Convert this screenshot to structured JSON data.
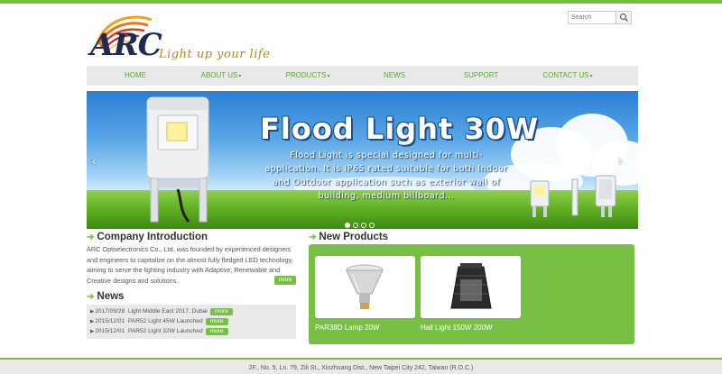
{
  "brand": {
    "logo_text": "ARC",
    "tagline": "Light up your life"
  },
  "search": {
    "placeholder": "Search",
    "icon": "search-icon"
  },
  "nav": {
    "items": [
      {
        "label": "HOME",
        "has_dropdown": false
      },
      {
        "label": "ABOUT US",
        "has_dropdown": true
      },
      {
        "label": "PRODUCTS",
        "has_dropdown": true
      },
      {
        "label": "NEWS",
        "has_dropdown": false
      },
      {
        "label": "SUPPORT",
        "has_dropdown": false
      },
      {
        "label": "CONTACT US",
        "has_dropdown": true
      }
    ],
    "caret": "▾"
  },
  "banner": {
    "title": "Flood Light 30W",
    "description": "Flood Light is special designed for multi-application. It is IP65 rated suitable for both Indoor and Outdoor application such as exterior wall of building, medium billboard...",
    "prev_arrow": "‹",
    "next_arrow": "›",
    "slide_count": 4,
    "active_slide": 1
  },
  "intro": {
    "title": "Company Introduction",
    "text": "ARC Optoelectronics Co., Ltd. was founded by experienced designers and engineers to capitalize on the almost fully fledged LED technology, aiming to serve the lighting industry with Adaptive, Renewable and Creative designs and solutions.",
    "more_label": "more"
  },
  "news": {
    "title": "News",
    "items": [
      {
        "date": "2017/09/28",
        "headline": "Light Middle East 2017, Dubai",
        "more_label": "more"
      },
      {
        "date": "2015/12/01",
        "headline": "PAR52 Light 45W Launched",
        "more_label": "more"
      },
      {
        "date": "2015/12/01",
        "headline": "PAR52 Light 32W Launched",
        "more_label": "more"
      }
    ]
  },
  "products": {
    "title": "New Products",
    "items": [
      {
        "name": "PAR38D Lamp 20W"
      },
      {
        "name": "Hall Light 150W 200W"
      }
    ]
  },
  "footer": {
    "address": "2F., No. 5, Ln. 79, Zili St., Xinzhuang Dist., New Taipei City 242, Taiwan (R.O.C.)"
  },
  "colors": {
    "accent_green": "#78c043",
    "nav_text": "#58a82c",
    "logo_navy": "#1d2b4f",
    "tagline_gold": "#b58b10"
  }
}
